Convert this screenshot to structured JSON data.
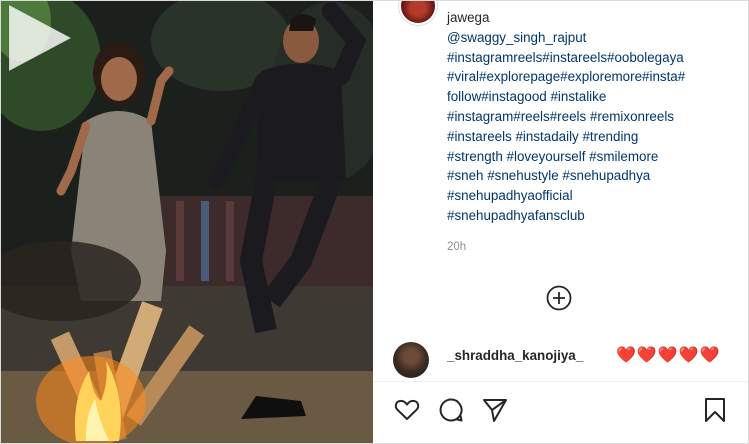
{
  "post": {
    "caption_lines": [
      "jawega",
      "@swaggy_singh_rajput",
      "#instagramreels#instareels#oobolegaya",
      "#viral#explorepage#exploremore#insta#",
      "follow#instagood #instalike",
      "#instagram#reels#reels #remixonreels",
      "#instareels #instadaily #trending",
      "#strength #loveyourself #smilemore",
      "#sneh #snehustyle #snehupadhya",
      "#snehupadhyaofficial",
      "#snehupadhyafansclub"
    ],
    "timestamp": "20h"
  },
  "comment": {
    "username": "_shraddha_kanojiya_",
    "text": "❤️❤️❤️❤️❤️"
  },
  "icons": {
    "play": "play-icon",
    "load_more": "plus-circle-icon",
    "like": "heart-icon",
    "comment": "comment-icon",
    "share": "send-icon",
    "save": "bookmark-icon"
  },
  "colors": {
    "link": "#00376b",
    "text": "#262626",
    "muted": "#8e8e8e",
    "heart": "#e0262e"
  }
}
